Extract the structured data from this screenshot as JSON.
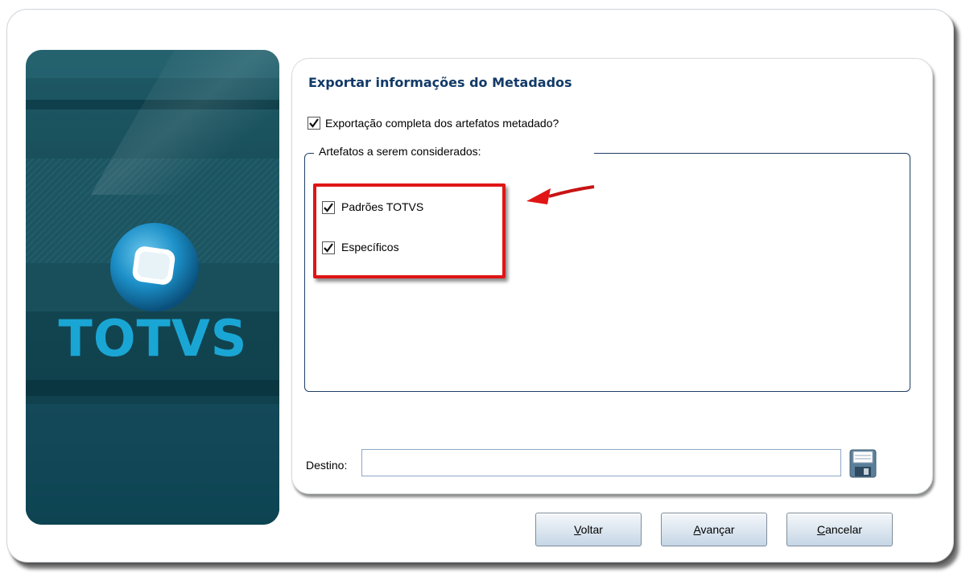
{
  "brand": {
    "logo_text": "TOTVS"
  },
  "dialog": {
    "title": "Exportar informações do Metadados",
    "full_export": {
      "label": "Exportação completa dos artefatos metadado?",
      "checked": true
    },
    "group": {
      "legend": "Artefatos a serem considerados:",
      "items": [
        {
          "label": "Padrões TOTVS",
          "checked": true
        },
        {
          "label": "Específicos",
          "checked": true
        }
      ]
    },
    "destination": {
      "label": "Destino:",
      "value": ""
    }
  },
  "buttons": {
    "back": {
      "mnemonic": "V",
      "rest": "oltar"
    },
    "next": {
      "mnemonic": "A",
      "rest": "vançar"
    },
    "cancel": {
      "mnemonic": "C",
      "rest": "ancelar"
    }
  },
  "colors": {
    "title": "#123a67",
    "highlight": "#e01515",
    "brand_text": "#1aa6d4"
  }
}
